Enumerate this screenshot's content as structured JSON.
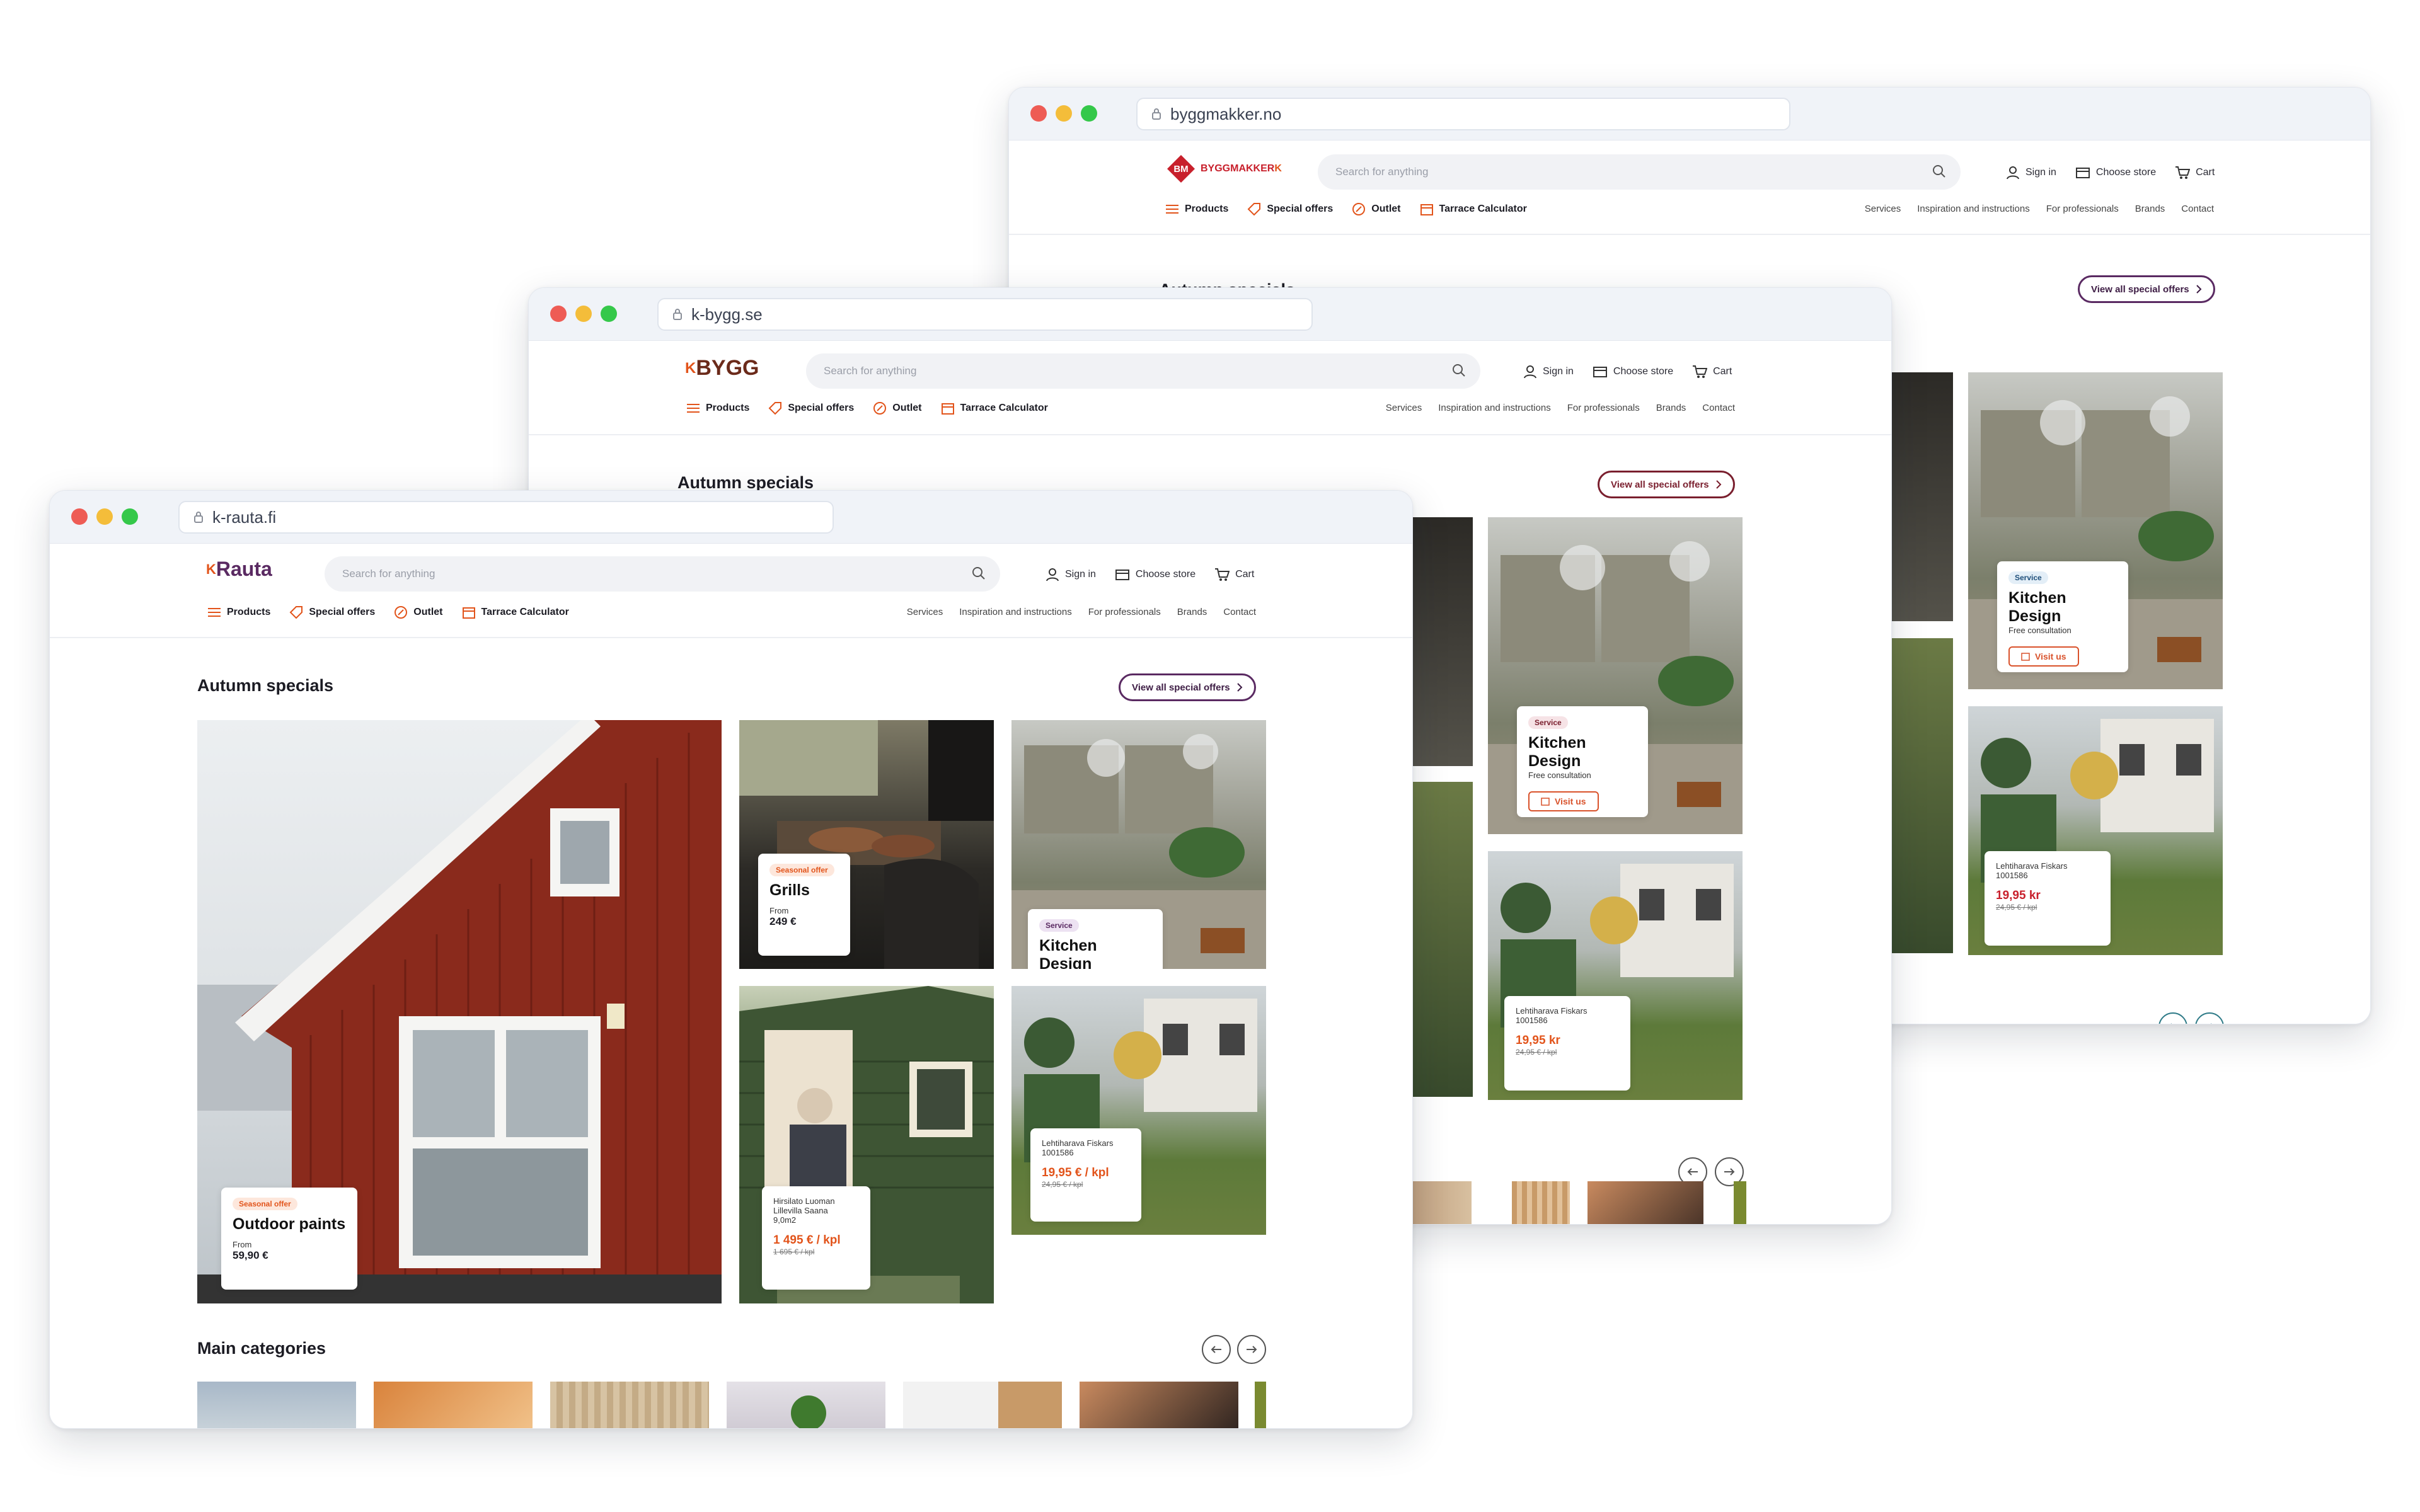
{
  "header": {
    "search_placeholder": "Search for anything",
    "sign_in": "Sign in",
    "choose_store": "Choose store",
    "cart": "Cart"
  },
  "nav": {
    "products": "Products",
    "special_offers": "Special offers",
    "outlet": "Outlet",
    "calculator": "Tarrace Calculator"
  },
  "nav_secondary": [
    "Services",
    "Inspiration and instructions",
    "For professionals",
    "Brands",
    "Contact"
  ],
  "windows": {
    "back": {
      "url": "byggmakker.no",
      "logo_text": "BYGGMAKKER",
      "logo_badge": "BM",
      "logo_suffix": "K"
    },
    "middle": {
      "url": "k-bygg.se",
      "logo_k": "K",
      "logo_text": "BYGG"
    },
    "front": {
      "url": "k-rauta.fi",
      "logo_k": "K",
      "logo_text": "Rauta"
    }
  },
  "section": {
    "title": "Autumn specials",
    "view_all": "View all special offers",
    "categories_title": "Main categories"
  },
  "tiles": {
    "paints": {
      "badge": "Seasonal offer",
      "title": "Outdoor paints",
      "from": "From",
      "price": "59,90 €"
    },
    "grills": {
      "badge": "Seasonal offer",
      "title": "Grills",
      "from": "From",
      "price": "249 €"
    },
    "kitchen": {
      "badge": "Service",
      "title": "Kitchen Design",
      "sub": "Free consultation",
      "cta": "Visit us"
    },
    "shed": {
      "name1": "Hirsilato Luoman",
      "name2": "Lillevilla Saana",
      "name3": "9,0m2",
      "price": "1 495 € / kpl",
      "old": "1 695 € / kpl"
    },
    "rake_fi": {
      "name1": "Lehtiharava Fiskars",
      "name2": "1001586",
      "price": "19,95 € / kpl",
      "old": "24,95 € / kpl"
    },
    "rake_se": {
      "name1": "Lehtiharava Fiskars",
      "name2": "1001586",
      "price": "19,95 kr",
      "old": "24,95 € / kpl"
    }
  },
  "colors": {
    "accent_purple": "#5a2a62",
    "accent_orange": "#e2541b",
    "accent_red": "#c8202c",
    "kbygg_brown": "#6b2a1a"
  }
}
